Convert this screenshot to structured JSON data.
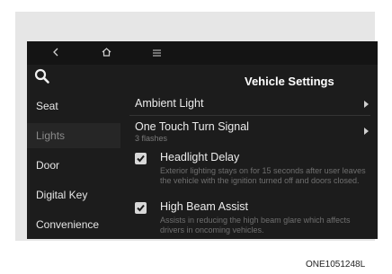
{
  "topbar": {
    "back_icon": "chevron-left-icon",
    "home_icon": "home-icon",
    "menu_icon": "hamburger-menu-icon"
  },
  "page_title": "Vehicle Settings",
  "sidebar": {
    "search_icon": "search-icon",
    "items": [
      {
        "label": "Seat",
        "active": false
      },
      {
        "label": "Lights",
        "active": true
      },
      {
        "label": "Door",
        "active": false
      },
      {
        "label": "Digital Key",
        "active": false
      },
      {
        "label": "Convenience",
        "active": false
      }
    ]
  },
  "settings": {
    "ambient_light": {
      "label": "Ambient Light"
    },
    "one_touch_turn_signal": {
      "label": "One Touch Turn Signal",
      "value": "3 flashes"
    },
    "headlight_delay": {
      "label": "Headlight Delay",
      "checked": true,
      "description": "Exterior lighting stays on for 15 seconds after user leaves the vehicle with the ignition turned off and doors closed."
    },
    "high_beam_assist": {
      "label": "High Beam Assist",
      "checked": true,
      "description": "Assists in reducing the high beam glare which affects drivers in oncoming vehicles."
    }
  },
  "caption": "ONE1051248L",
  "colors": {
    "screen_bg": "#1c1c1c",
    "active_item_bg": "#262626",
    "frame_bg": "#e6e6e6"
  }
}
